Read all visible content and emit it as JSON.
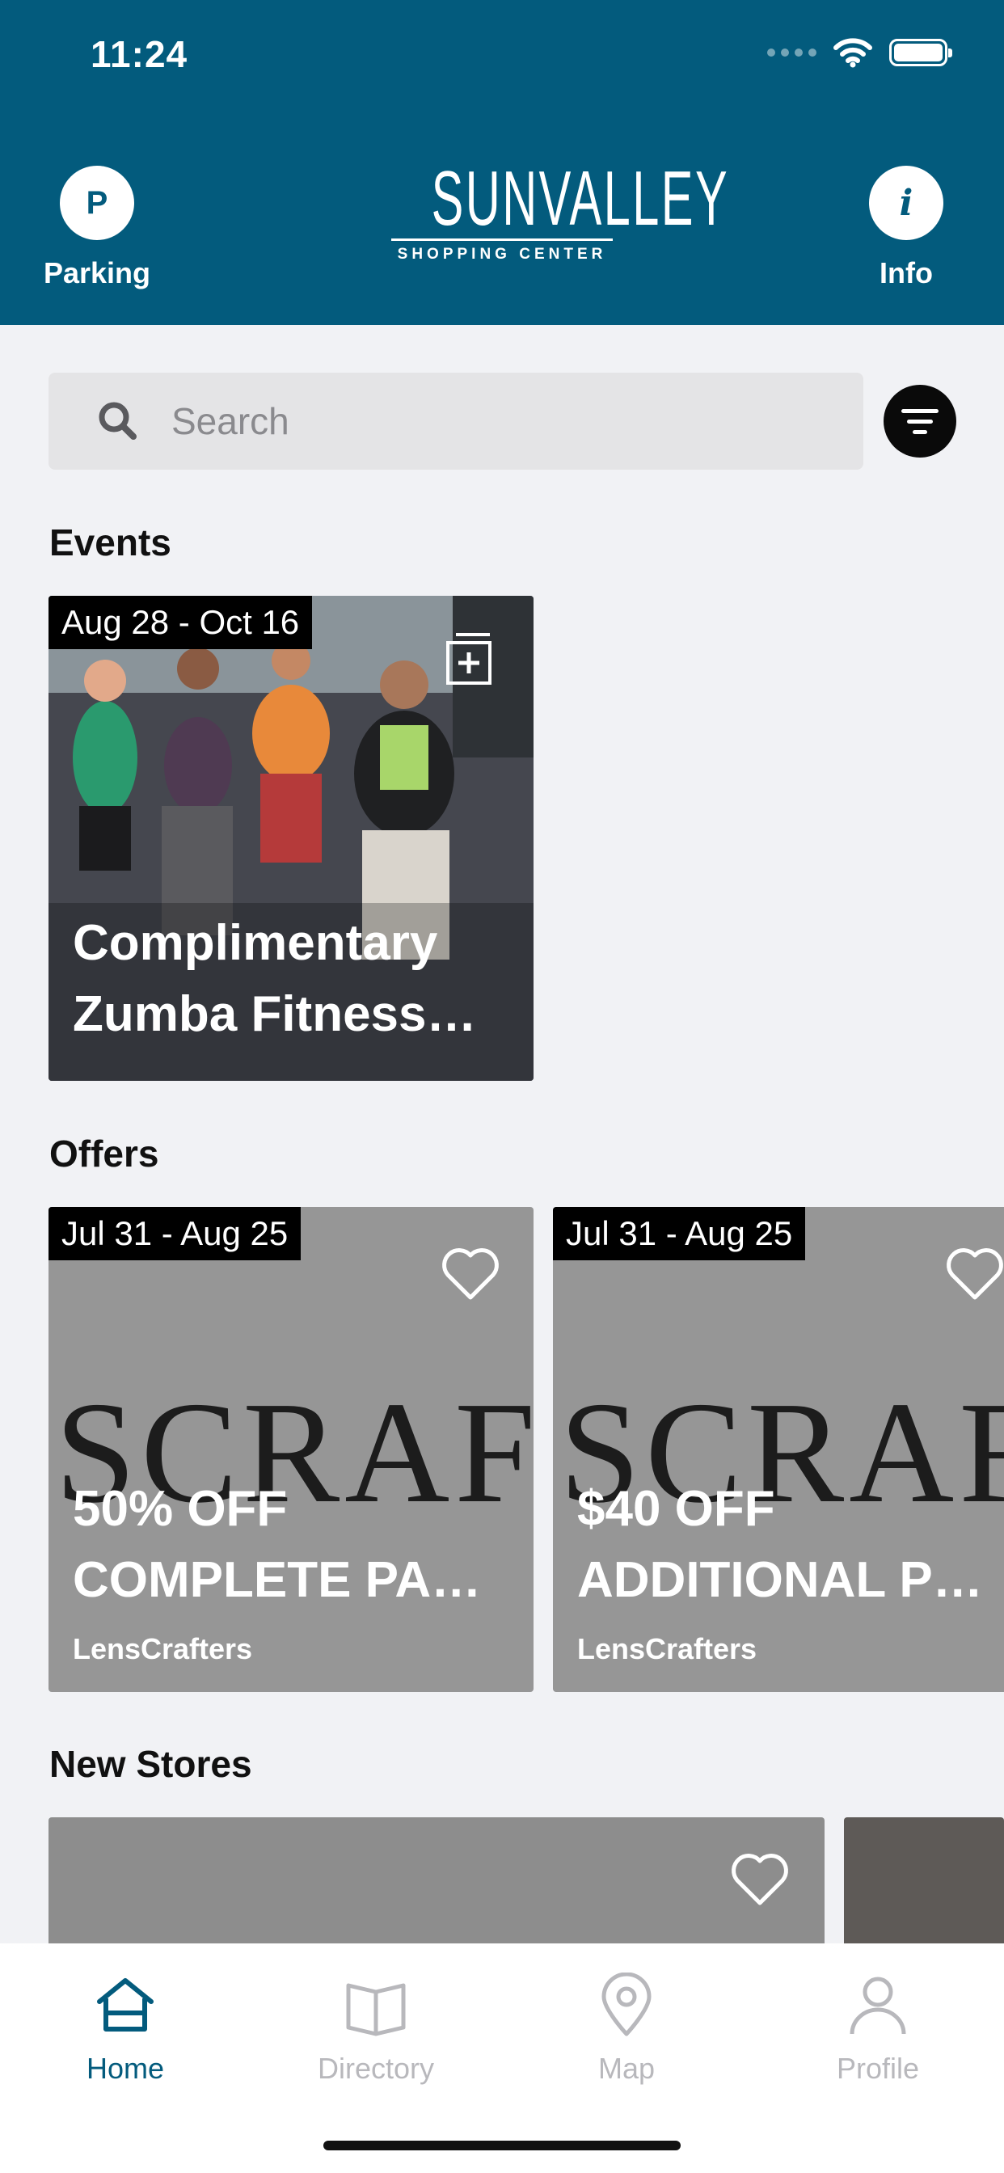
{
  "status_bar": {
    "time": "11:24"
  },
  "header": {
    "parking": {
      "icon_letter": "P",
      "label": "Parking"
    },
    "info": {
      "icon_letter": "i",
      "label": "Info"
    },
    "logo": {
      "main": "SUNVALLEY",
      "sub": "SHOPPING CENTER"
    },
    "background_color": "#035b7d"
  },
  "search": {
    "placeholder": "Search"
  },
  "events": {
    "title": "Events",
    "items": [
      {
        "date_range": "Aug 28 - Oct 16",
        "title": "Complimentary Zumba Fitness…"
      }
    ]
  },
  "offers": {
    "title": "Offers",
    "items": [
      {
        "date_range": "Jul 31 - Aug 25",
        "title": "50% OFF COMPLETE PA…",
        "store": "LensCrafters",
        "image_text": "SCRAFT"
      },
      {
        "date_range": "Jul 31 - Aug 25",
        "title": "$40 OFF ADDITIONAL P…",
        "store": "LensCrafters",
        "image_text": "SCRAFT"
      }
    ]
  },
  "new_stores": {
    "title": "New Stores"
  },
  "tabbar": {
    "items": [
      {
        "label": "Home",
        "icon": "home-icon",
        "active": true
      },
      {
        "label": "Directory",
        "icon": "book-icon",
        "active": false
      },
      {
        "label": "Map",
        "icon": "map-pin-icon",
        "active": false
      },
      {
        "label": "Profile",
        "icon": "user-icon",
        "active": false
      }
    ],
    "active_color": "#035b7d",
    "inactive_color": "#b8b8bc"
  }
}
